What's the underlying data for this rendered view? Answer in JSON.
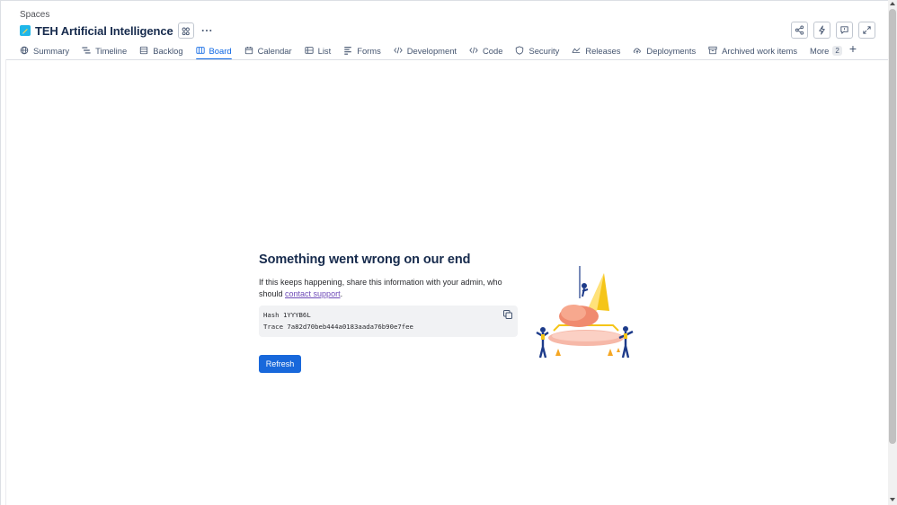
{
  "breadcrumb": "Spaces",
  "project": {
    "title": "TEH Artificial Intelligence",
    "icon": "project-avatar-icon",
    "icon_color": "#1fb6e8"
  },
  "header_actions": [
    {
      "name": "share-icon"
    },
    {
      "name": "lightning-icon"
    },
    {
      "name": "feedback-icon"
    },
    {
      "name": "expand-icon"
    }
  ],
  "tabs": [
    {
      "label": "Summary",
      "icon": "globe-icon"
    },
    {
      "label": "Timeline",
      "icon": "timeline-icon"
    },
    {
      "label": "Backlog",
      "icon": "backlog-icon"
    },
    {
      "label": "Board",
      "icon": "board-icon",
      "active": true
    },
    {
      "label": "Calendar",
      "icon": "calendar-icon"
    },
    {
      "label": "List",
      "icon": "list-icon"
    },
    {
      "label": "Forms",
      "icon": "forms-icon"
    },
    {
      "label": "Development",
      "icon": "development-icon"
    },
    {
      "label": "Code",
      "icon": "code-icon"
    },
    {
      "label": "Security",
      "icon": "shield-icon"
    },
    {
      "label": "Releases",
      "icon": "releases-icon"
    },
    {
      "label": "Deployments",
      "icon": "deployments-icon"
    },
    {
      "label": "Archived work items",
      "icon": "archive-icon"
    }
  ],
  "more_tab": {
    "label": "More",
    "count": "2"
  },
  "error": {
    "heading": "Something went wrong on our end",
    "message_before": "If this keeps happening, share this information with your admin, who should ",
    "link_text": "contact support",
    "message_after": ".",
    "hash_line": "Hash 1YYYB6L",
    "trace_line": "Trace 7a82d70beb444a0183aada76b90e7fee",
    "refresh_label": "Refresh"
  },
  "colors": {
    "accent": "#0c66e4",
    "button": "#1868db",
    "link": "#6e4bb8"
  }
}
